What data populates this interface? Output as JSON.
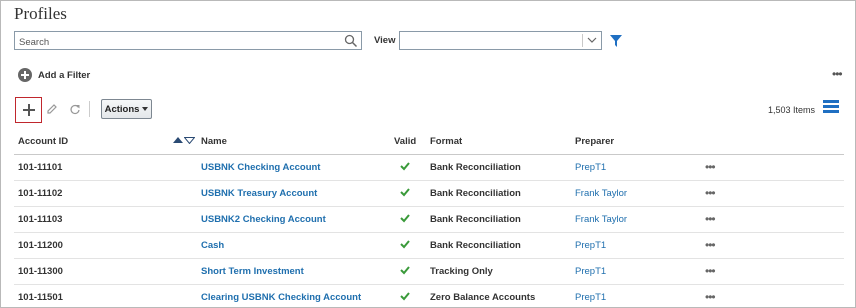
{
  "page": {
    "title": "Profiles"
  },
  "search": {
    "placeholder": "Search",
    "value": ""
  },
  "view": {
    "label": "View",
    "selected": ""
  },
  "filters": {
    "add_label": "Add a Filter"
  },
  "toolbar": {
    "actions_label": "Actions",
    "items_count": "1,503 Items"
  },
  "table": {
    "columns": [
      "Account ID",
      "Name",
      "Valid",
      "Format",
      "Preparer"
    ],
    "rows": [
      {
        "id": "101-11101",
        "name": "USBNK Checking Account",
        "valid": true,
        "format": "Bank Reconciliation",
        "preparer": "PrepT1"
      },
      {
        "id": "101-11102",
        "name": "USBNK Treasury Account",
        "valid": true,
        "format": "Bank Reconciliation",
        "preparer": "Frank Taylor"
      },
      {
        "id": "101-11103",
        "name": "USBNK2 Checking Account",
        "valid": true,
        "format": "Bank Reconciliation",
        "preparer": "Frank Taylor"
      },
      {
        "id": "101-11200",
        "name": "Cash",
        "valid": true,
        "format": "Bank Reconciliation",
        "preparer": "PrepT1"
      },
      {
        "id": "101-11300",
        "name": "Short Term Investment",
        "valid": true,
        "format": "Tracking Only",
        "preparer": "PrepT1"
      },
      {
        "id": "101-11501",
        "name": "Clearing USBNK Checking Account",
        "valid": true,
        "format": "Zero Balance Accounts",
        "preparer": "PrepT1"
      }
    ]
  },
  "colors": {
    "link": "#1f6fae",
    "check": "#3a9a3a",
    "accent": "#1f6fc2",
    "highlight_border": "#c0272d"
  },
  "icons": {
    "search": "search-icon",
    "filter": "filter-icon",
    "add": "plus-icon",
    "edit": "pencil-icon",
    "refresh": "refresh-icon",
    "more": "more-icon",
    "list": "list-view-icon",
    "valid": "check-icon"
  }
}
